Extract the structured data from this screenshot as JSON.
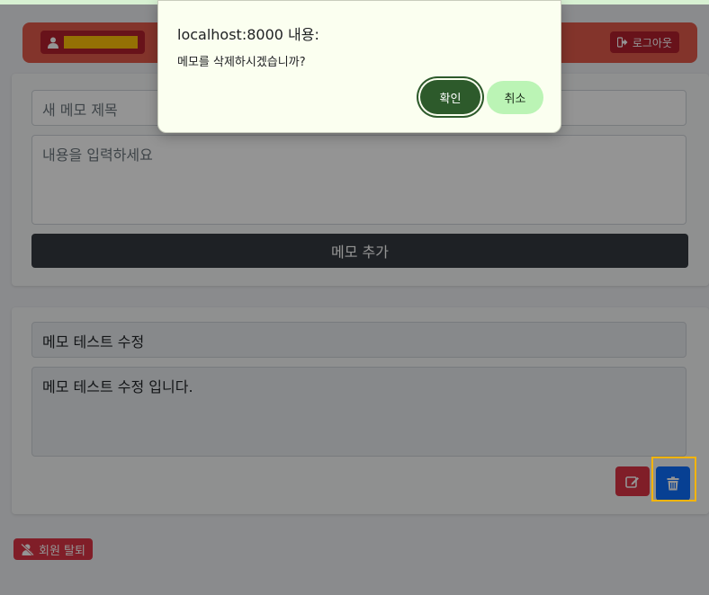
{
  "navbar": {
    "logout_label": "로그아웃"
  },
  "new_memo": {
    "title_placeholder": "새 메모 제목",
    "content_placeholder": "내용을 입력하세요",
    "add_label": "메모 추가"
  },
  "memos": [
    {
      "title": "메모 테스트 수정",
      "content": "메모 테스트 수정 입니다."
    }
  ],
  "account": {
    "withdraw_label": "회원 탈퇴"
  },
  "dialog": {
    "title": "localhost:8000 내용:",
    "message": "메모를 삭제하시겠습니까?",
    "ok_label": "확인",
    "cancel_label": "취소"
  },
  "colors": {
    "highlight": "#f5b400",
    "dialog_ok": "#2d5a2b",
    "dialog_cancel": "#bbf4b5"
  },
  "icons": [
    "user-icon",
    "logout-icon",
    "edit-icon",
    "trash-icon",
    "user-slash-icon"
  ]
}
